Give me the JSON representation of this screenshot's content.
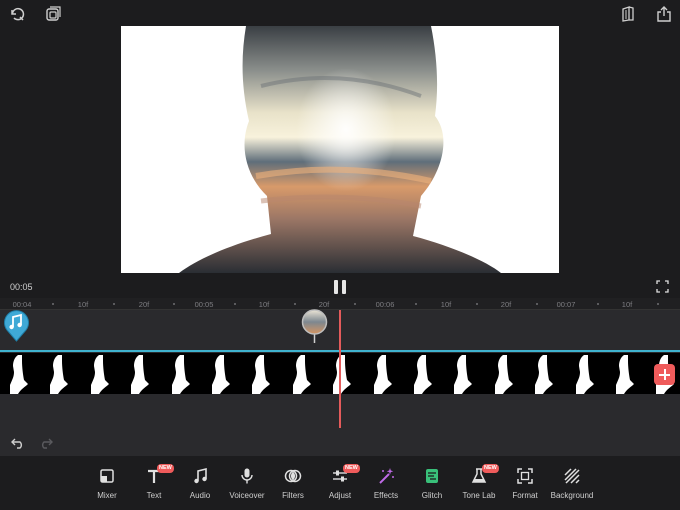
{
  "topbar": {
    "left_icons": [
      "reset-rotate-icon",
      "multi-layer-icon"
    ],
    "right_icons": [
      "project-book-icon",
      "share-upload-icon"
    ]
  },
  "player": {
    "current_time": "00:05",
    "state": "playing",
    "pause_icon": "pause-icon",
    "fullscreen_icon": "fullscreen-icon"
  },
  "timeline": {
    "ruler": [
      "00:04",
      "10f",
      "20f",
      "00:05",
      "10f",
      "20f",
      "00:06",
      "10f",
      "20f",
      "00:07",
      "10f"
    ],
    "audio_marker_icon": "music-note-icon",
    "track_color": "#3fb3cf",
    "playhead_color": "#e45b5b",
    "add_clip_color": "#ef5b5b"
  },
  "history": {
    "undo_icon": "undo-icon",
    "redo_icon": "redo-icon"
  },
  "toolbar": {
    "items": [
      {
        "label": "Mixer",
        "icon": "mixer-icon"
      },
      {
        "label": "Text",
        "icon": "text-icon",
        "badge": "NEW"
      },
      {
        "label": "Audio",
        "icon": "music-icon"
      },
      {
        "label": "Voiceover",
        "icon": "microphone-icon"
      },
      {
        "label": "Filters",
        "icon": "filters-icon"
      },
      {
        "label": "Adjust",
        "icon": "adjust-sliders-icon",
        "badge": "NEW"
      },
      {
        "label": "Effects",
        "icon": "magic-wand-icon"
      },
      {
        "label": "Glitch",
        "icon": "glitch-icon"
      },
      {
        "label": "Tone Lab",
        "icon": "flask-icon",
        "badge": "NEW"
      },
      {
        "label": "Format",
        "icon": "format-frame-icon"
      },
      {
        "label": "Background",
        "icon": "background-stripes-icon"
      }
    ]
  },
  "colors": {
    "accent_blue": "#3fb3cf",
    "accent_red": "#ef5b5b",
    "effects_purple": "#c06be8",
    "glitch_green": "#39c07a"
  }
}
